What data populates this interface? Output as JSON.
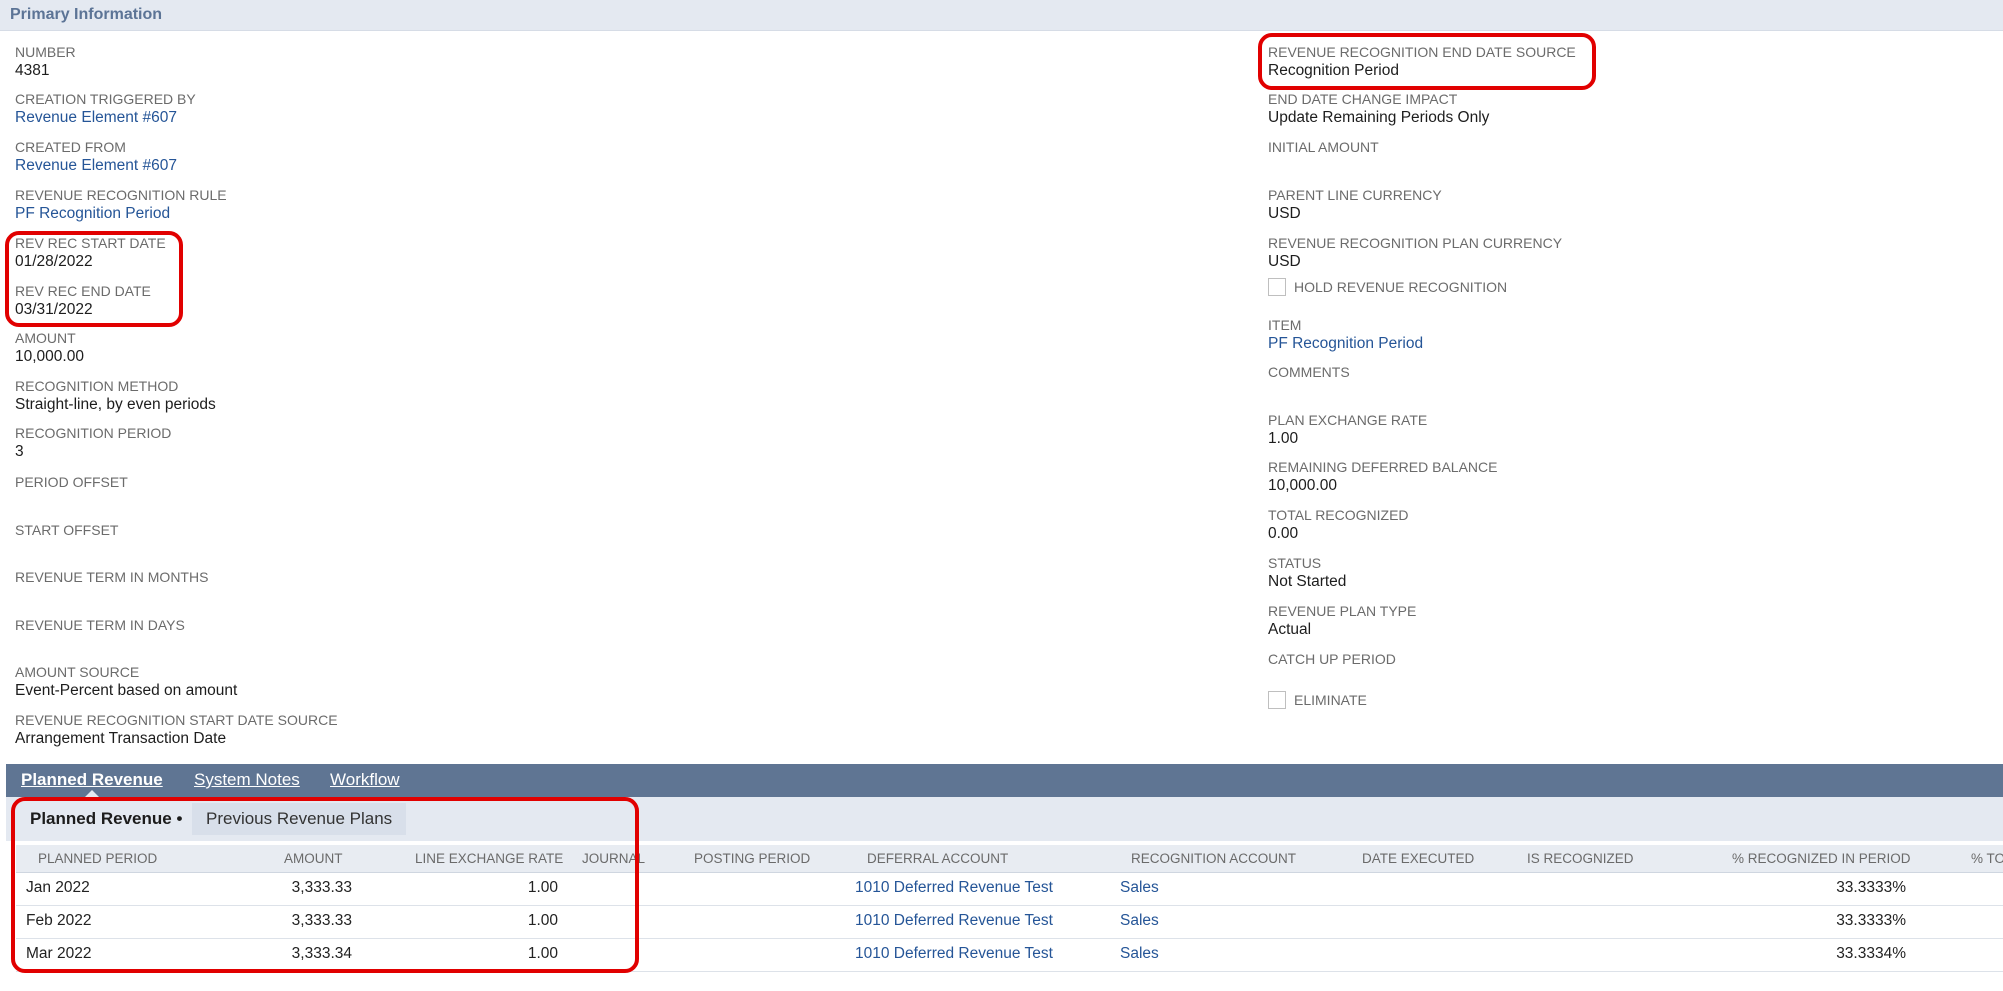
{
  "section": {
    "title": "Primary Information"
  },
  "left_fields": [
    {
      "label": "NUMBER",
      "value": "4381",
      "link": false
    },
    {
      "label": "CREATION TRIGGERED BY",
      "value": "Revenue Element #607",
      "link": true
    },
    {
      "label": "CREATED FROM",
      "value": "Revenue Element #607",
      "link": true
    },
    {
      "label": "REVENUE RECOGNITION RULE",
      "value": "PF Recognition Period",
      "link": true
    },
    {
      "label": "REV REC START DATE",
      "value": "01/28/2022",
      "link": false
    },
    {
      "label": "REV REC END DATE",
      "value": "03/31/2022",
      "link": false
    },
    {
      "label": "AMOUNT",
      "value": "10,000.00",
      "link": false
    },
    {
      "label": "RECOGNITION METHOD",
      "value": "Straight-line, by even periods",
      "link": false
    },
    {
      "label": "RECOGNITION PERIOD",
      "value": "3",
      "link": false
    },
    {
      "label": "PERIOD OFFSET",
      "value": "",
      "link": false
    },
    {
      "label": "START OFFSET",
      "value": "",
      "link": false
    },
    {
      "label": "REVENUE TERM IN MONTHS",
      "value": "",
      "link": false
    },
    {
      "label": "REVENUE TERM IN DAYS",
      "value": "",
      "link": false
    },
    {
      "label": "AMOUNT SOURCE",
      "value": "Event-Percent based on amount",
      "link": false
    },
    {
      "label": "REVENUE RECOGNITION START DATE SOURCE",
      "value": "Arrangement Transaction Date",
      "link": false
    }
  ],
  "right_fields": [
    {
      "label": "REVENUE RECOGNITION END DATE SOURCE",
      "value": "Recognition Period",
      "link": false
    },
    {
      "label": "END DATE CHANGE IMPACT",
      "value": "Update Remaining Periods Only",
      "link": false
    },
    {
      "label": "INITIAL AMOUNT",
      "value": "",
      "link": false
    },
    {
      "label": "PARENT LINE CURRENCY",
      "value": "USD",
      "link": false
    },
    {
      "label": "REVENUE RECOGNITION PLAN CURRENCY",
      "value": "USD",
      "link": false
    },
    {
      "label": "HOLD REVENUE RECOGNITION",
      "checkbox": true,
      "checked": false
    },
    {
      "label": "ITEM",
      "value": "PF Recognition Period",
      "link": true
    },
    {
      "label": "COMMENTS",
      "value": "",
      "link": false
    },
    {
      "label": "PLAN EXCHANGE RATE",
      "value": "1.00",
      "link": false
    },
    {
      "label": "REMAINING DEFERRED BALANCE",
      "value": "10,000.00",
      "link": false
    },
    {
      "label": "TOTAL RECOGNIZED",
      "value": "0.00",
      "link": false
    },
    {
      "label": "STATUS",
      "value": "Not Started",
      "link": false
    },
    {
      "label": "REVENUE PLAN TYPE",
      "value": "Actual",
      "link": false
    },
    {
      "label": "CATCH UP PERIOD",
      "value": "",
      "link": false
    },
    {
      "label": "ELIMINATE",
      "checkbox": true,
      "checked": false
    }
  ],
  "subtabs": [
    "Planned Revenue",
    "System Notes",
    "Workflow"
  ],
  "inner_tabs": [
    "Planned Revenue",
    "Previous Revenue Plans"
  ],
  "table": {
    "columns": [
      "PLANNED PERIOD",
      "AMOUNT",
      "LINE EXCHANGE RATE",
      "JOURNAL",
      "POSTING PERIOD",
      "DEFERRAL ACCOUNT",
      "RECOGNITION ACCOUNT",
      "DATE EXECUTED",
      "IS RECOGNIZED",
      "% RECOGNIZED IN PERIOD",
      "% TOTAL"
    ],
    "rows": [
      [
        "Jan 2022",
        "3,333.33",
        "1.00",
        "",
        "",
        "1010 Deferred Revenue Test",
        "Sales",
        "",
        "",
        "33.3333%",
        ""
      ],
      [
        "Feb 2022",
        "3,333.33",
        "1.00",
        "",
        "",
        "1010 Deferred Revenue Test",
        "Sales",
        "",
        "",
        "33.3333%",
        ""
      ],
      [
        "Mar 2022",
        "3,333.34",
        "1.00",
        "",
        "",
        "1010 Deferred Revenue Test",
        "Sales",
        "",
        "",
        "33.3334%",
        ""
      ]
    ]
  }
}
